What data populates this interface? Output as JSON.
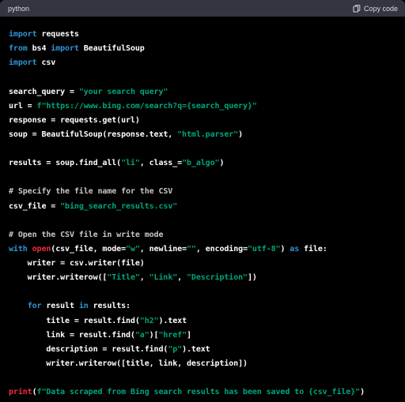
{
  "header": {
    "language": "python",
    "copy_label": "Copy code"
  },
  "colors": {
    "background": "#000000",
    "header_bg": "#343541",
    "keyword": "#2e95d3",
    "string": "#00a67d",
    "comment": "#c8c8c8",
    "builtin": "#f22c3d",
    "text": "#ffffff"
  },
  "code_lines": [
    [
      [
        "kw",
        "import"
      ],
      [
        "t",
        " requests"
      ]
    ],
    [
      [
        "kw",
        "from"
      ],
      [
        "t",
        " bs4 "
      ],
      [
        "kw",
        "import"
      ],
      [
        "t",
        " BeautifulSoup"
      ]
    ],
    [
      [
        "kw",
        "import"
      ],
      [
        "t",
        " csv"
      ]
    ],
    [],
    [
      [
        "t",
        "search_query = "
      ],
      [
        "str",
        "\"your search query\""
      ]
    ],
    [
      [
        "t",
        "url = "
      ],
      [
        "str",
        "f\"https://www.bing.com/search?q={search_query}\""
      ]
    ],
    [
      [
        "t",
        "response = requests.get(url)"
      ]
    ],
    [
      [
        "t",
        "soup = BeautifulSoup(response.text, "
      ],
      [
        "str",
        "\"html.parser\""
      ],
      [
        "t",
        ")"
      ]
    ],
    [],
    [
      [
        "t",
        "results = soup.find_all("
      ],
      [
        "str",
        "\"li\""
      ],
      [
        "t",
        ", class_="
      ],
      [
        "str",
        "\"b_algo\""
      ],
      [
        "t",
        ")"
      ]
    ],
    [],
    [
      [
        "cm",
        "# Specify the file name for the CSV"
      ]
    ],
    [
      [
        "t",
        "csv_file = "
      ],
      [
        "str",
        "\"bing_search_results.csv\""
      ]
    ],
    [],
    [
      [
        "cm",
        "# Open the CSV file in write mode"
      ]
    ],
    [
      [
        "kw",
        "with"
      ],
      [
        "t",
        " "
      ],
      [
        "fn",
        "open"
      ],
      [
        "t",
        "(csv_file, mode="
      ],
      [
        "str",
        "\"w\""
      ],
      [
        "t",
        ", newline="
      ],
      [
        "str",
        "\"\""
      ],
      [
        "t",
        ", encoding="
      ],
      [
        "str",
        "\"utf-8\""
      ],
      [
        "t",
        ") "
      ],
      [
        "kw",
        "as"
      ],
      [
        "t",
        " file:"
      ]
    ],
    [
      [
        "t",
        "    writer = csv.writer(file)"
      ]
    ],
    [
      [
        "t",
        "    writer.writerow(["
      ],
      [
        "str",
        "\"Title\""
      ],
      [
        "t",
        ", "
      ],
      [
        "str",
        "\"Link\""
      ],
      [
        "t",
        ", "
      ],
      [
        "str",
        "\"Description\""
      ],
      [
        "t",
        "])"
      ]
    ],
    [],
    [
      [
        "t",
        "    "
      ],
      [
        "kw",
        "for"
      ],
      [
        "t",
        " result "
      ],
      [
        "kw",
        "in"
      ],
      [
        "t",
        " results:"
      ]
    ],
    [
      [
        "t",
        "        title = result.find("
      ],
      [
        "str",
        "\"h2\""
      ],
      [
        "t",
        ").text"
      ]
    ],
    [
      [
        "t",
        "        link = result.find("
      ],
      [
        "str",
        "\"a\""
      ],
      [
        "t",
        ")["
      ],
      [
        "str",
        "\"href\""
      ],
      [
        "t",
        "]"
      ]
    ],
    [
      [
        "t",
        "        description = result.find("
      ],
      [
        "str",
        "\"p\""
      ],
      [
        "t",
        ").text"
      ]
    ],
    [
      [
        "t",
        "        writer.writerow([title, link, description])"
      ]
    ],
    [],
    [
      [
        "fn",
        "print"
      ],
      [
        "t",
        "("
      ],
      [
        "str",
        "f\"Data scraped from Bing search results has been saved to {csv_file}\""
      ],
      [
        "t",
        ")"
      ]
    ]
  ]
}
